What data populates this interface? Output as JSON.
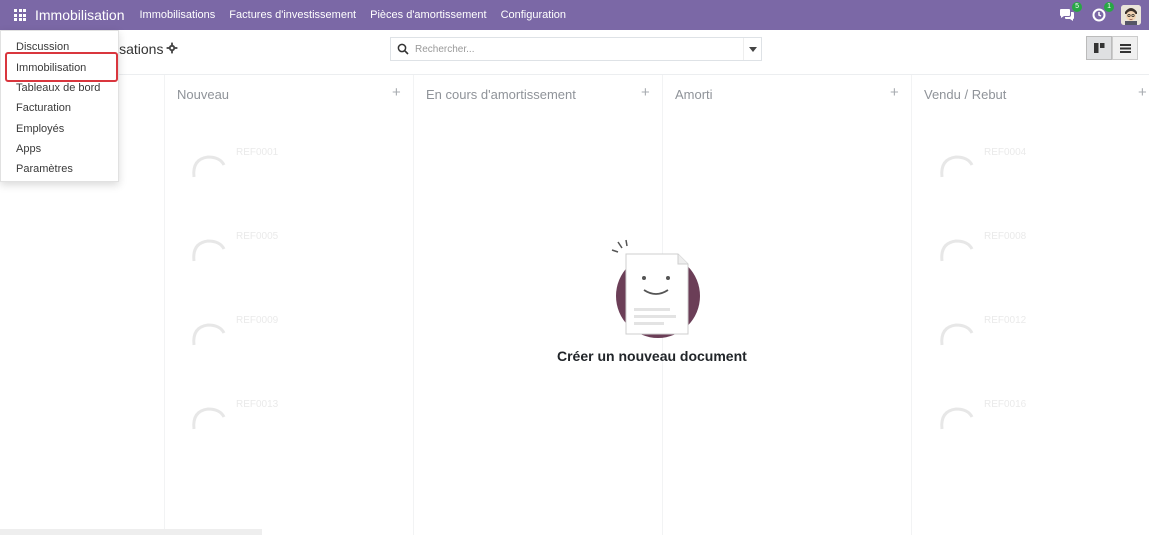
{
  "navbar": {
    "brand": "Immobilisation",
    "menu": [
      "Immobilisations",
      "Factures d'investissement",
      "Pièces d'amortissement",
      "Configuration"
    ],
    "messages_badge": "5",
    "activities_badge": "1",
    "color": "#7b68a6"
  },
  "control_panel": {
    "breadcrumb_visible": "isations",
    "search_placeholder": "Rechercher..."
  },
  "kanban": {
    "columns": [
      {
        "title": "Nouveau"
      },
      {
        "title": "En cours d'amortissement"
      },
      {
        "title": "Amorti"
      },
      {
        "title": "Vendu / Rebut"
      }
    ]
  },
  "ghost_cards": [
    {
      "ref": "REF0001"
    },
    {
      "ref": "REF0005"
    },
    {
      "ref": "REF0009"
    },
    {
      "ref": "REF0013"
    },
    {
      "ref": "REF0004"
    },
    {
      "ref": "REF0008"
    },
    {
      "ref": "REF0012"
    },
    {
      "ref": "REF0016"
    }
  ],
  "empty_state": {
    "title": "Créer un nouveau document"
  },
  "apps_dropdown": {
    "items": [
      "Discussion",
      "Immobilisation",
      "Tableaux de bord",
      "Facturation",
      "Employés",
      "Apps",
      "Paramètres"
    ],
    "highlighted": "Immobilisation"
  },
  "icons": {
    "apps": "apps-grid-icon",
    "search": "search-icon",
    "gear": "gear-icon",
    "messages": "chat-icon",
    "activities": "clock-icon",
    "kanban_view": "kanban-view-icon",
    "list_view": "list-view-icon"
  }
}
